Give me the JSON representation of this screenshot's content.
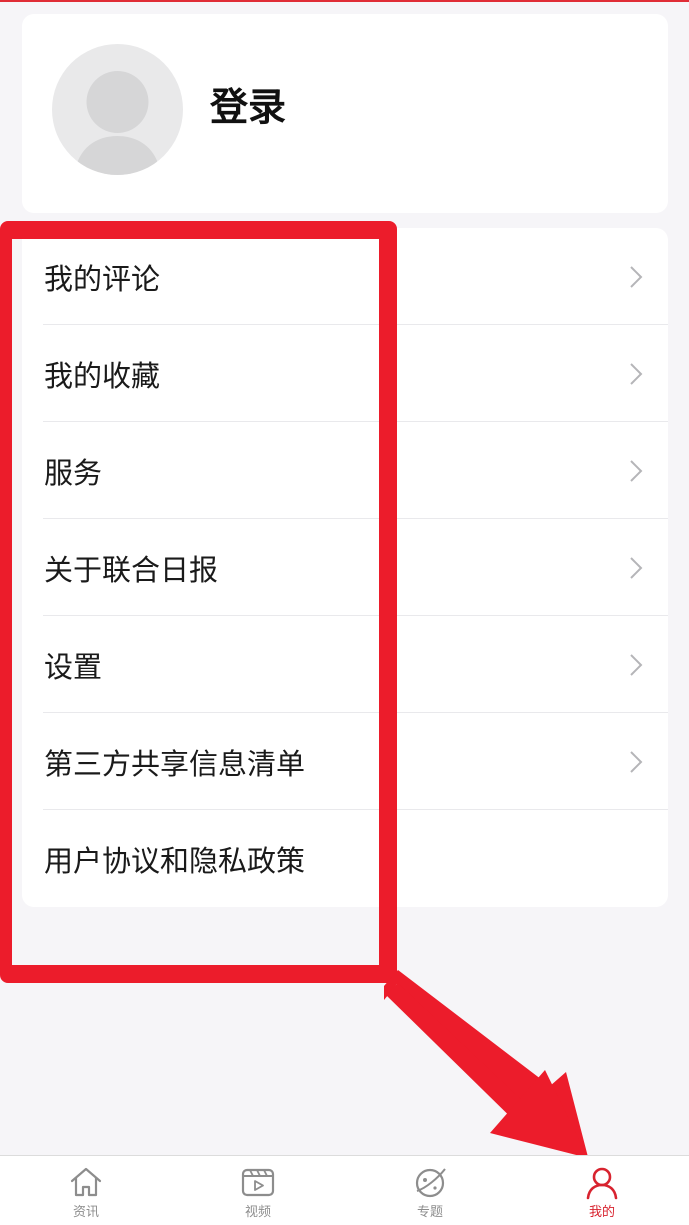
{
  "profile": {
    "login_label": "登录"
  },
  "menu": {
    "items": [
      {
        "label": "我的评论",
        "has_chevron": true
      },
      {
        "label": "我的收藏",
        "has_chevron": true
      },
      {
        "label": "服务",
        "has_chevron": true
      },
      {
        "label": "关于联合日报",
        "has_chevron": true
      },
      {
        "label": "设置",
        "has_chevron": true
      },
      {
        "label": "第三方共享信息清单",
        "has_chevron": true
      },
      {
        "label": "用户协议和隐私政策",
        "has_chevron": false
      }
    ]
  },
  "tabbar": {
    "tabs": [
      {
        "label": "资讯",
        "icon": "home-icon",
        "active": false
      },
      {
        "label": "视频",
        "icon": "video-icon",
        "active": false
      },
      {
        "label": "专题",
        "icon": "topic-icon",
        "active": false
      },
      {
        "label": "我的",
        "icon": "person-icon",
        "active": true
      }
    ]
  },
  "colors": {
    "accent": "#d8232f",
    "annotation": "#ec1c2b",
    "background": "#f6f5f8"
  }
}
